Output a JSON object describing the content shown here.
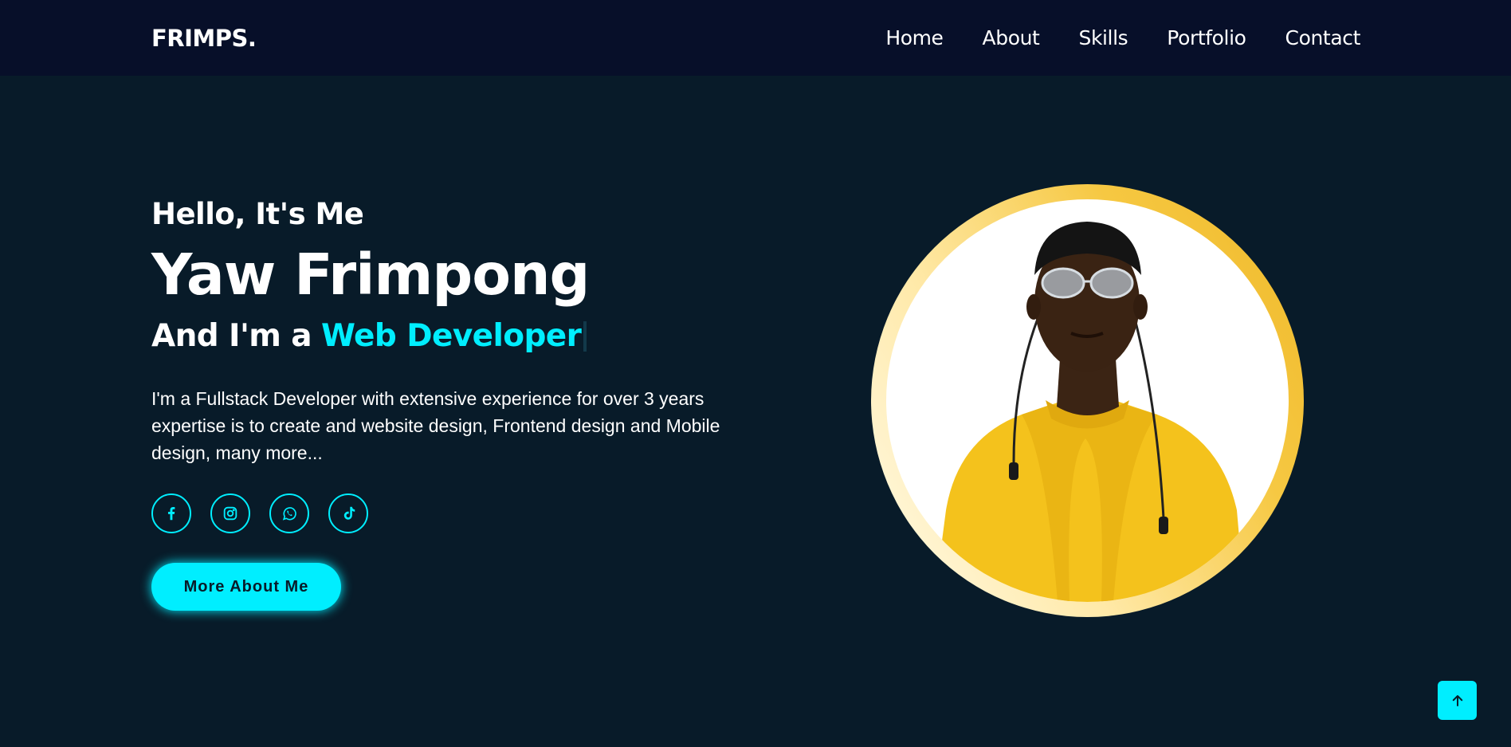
{
  "header": {
    "logo": "FRIMPS.",
    "nav": [
      "Home",
      "About",
      "Skills",
      "Portfolio",
      "Contact"
    ]
  },
  "hero": {
    "greeting": "Hello, It's Me",
    "name": "Yaw Frimpong",
    "role_prefix": "And I'm a",
    "role": "Web Developer",
    "description": "I'm a Fullstack Developer with extensive experience for over 3 years expertise is to create and website design, Frontend design and Mobile design, many more...",
    "socials": [
      "facebook-icon",
      "instagram-icon",
      "whatsapp-icon",
      "tiktok-icon"
    ],
    "button": "More About Me"
  },
  "colors": {
    "background": "#081b29",
    "header": "#070f29",
    "accent": "#00eeff",
    "ring": "#f6c842"
  },
  "back_to_top_icon": "arrow-up-icon"
}
